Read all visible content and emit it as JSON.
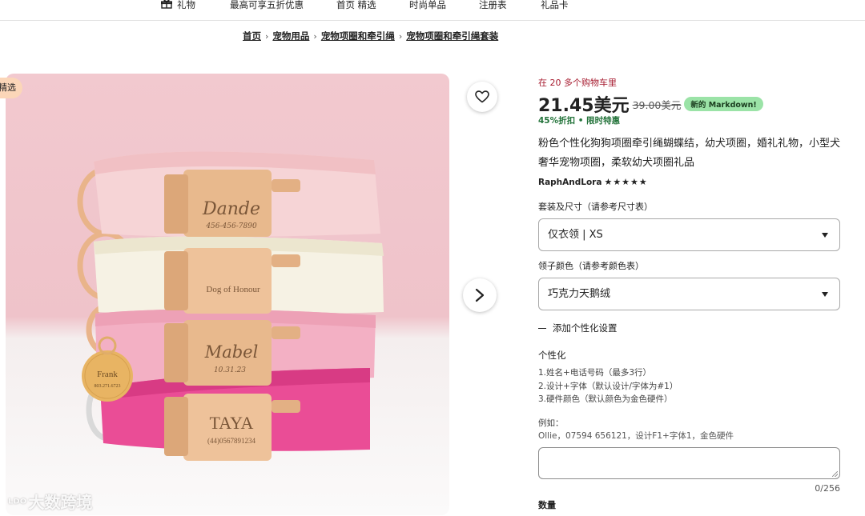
{
  "nav": {
    "items": [
      {
        "label": "礼物",
        "icon": "gift-icon"
      },
      {
        "label": "最高可享五折优惠"
      },
      {
        "label": "首页 精选"
      },
      {
        "label": "时尚单品"
      },
      {
        "label": "注册表"
      },
      {
        "label": "礼品卡"
      }
    ]
  },
  "breadcrumb": [
    "首页",
    "宠物用品",
    "宠物项圈和牵引绳",
    "宠物项圈和牵引绳套装"
  ],
  "photo": {
    "badge": "精选",
    "watermark": "大数跨境",
    "engravings": [
      "Dande",
      "456-456-7890",
      "Dog of Honour",
      "Mabel",
      "10.31.23",
      "TAYA",
      "(44)0567891234",
      "Frank",
      "803.271.6723"
    ]
  },
  "product": {
    "in_cart": "在 20 多个购物车里",
    "price": "21.45美元",
    "old_price": "39.00美元",
    "markdown_badge": "新的 Markdown!",
    "discount": "45%折扣 • 限时特惠",
    "title": "粉色个性化狗狗项圈牵引绳蝴蝶结，幼犬项圈，婚礼礼物，小型犬奢华宠物项圈，柔软幼犬项圈礼品",
    "seller": "RaphAndLora",
    "stars": "★★★★★",
    "rating": 5
  },
  "options": {
    "size_label": "套装及尺寸（请参考尺寸表）",
    "size_value": "仅衣领 | XS",
    "color_label": "领子颜色（请参考颜色表）",
    "color_value": "巧克力天鹅绒"
  },
  "personalization": {
    "toggle_label": "添加个性化设置",
    "heading": "个性化",
    "lines": [
      "1.姓名+电话号码（最多3行）",
      "2.设计+字体（默认设计/字体为#1）",
      "3.硬件颜色（默认颜色为金色硬件）"
    ],
    "example_label": "例如：",
    "example_text": "Ollie，07594 656121，设计F1+字体1，金色硬件",
    "counter": "0/256"
  },
  "quantity_label": "数量",
  "colors": {
    "price_red": "#a61a2e",
    "discount_green": "#23733a",
    "markdown_badge_bg": "#9be3a7",
    "badge_bg": "#fbd6b8",
    "photo_bg": "#f2c9cf"
  }
}
